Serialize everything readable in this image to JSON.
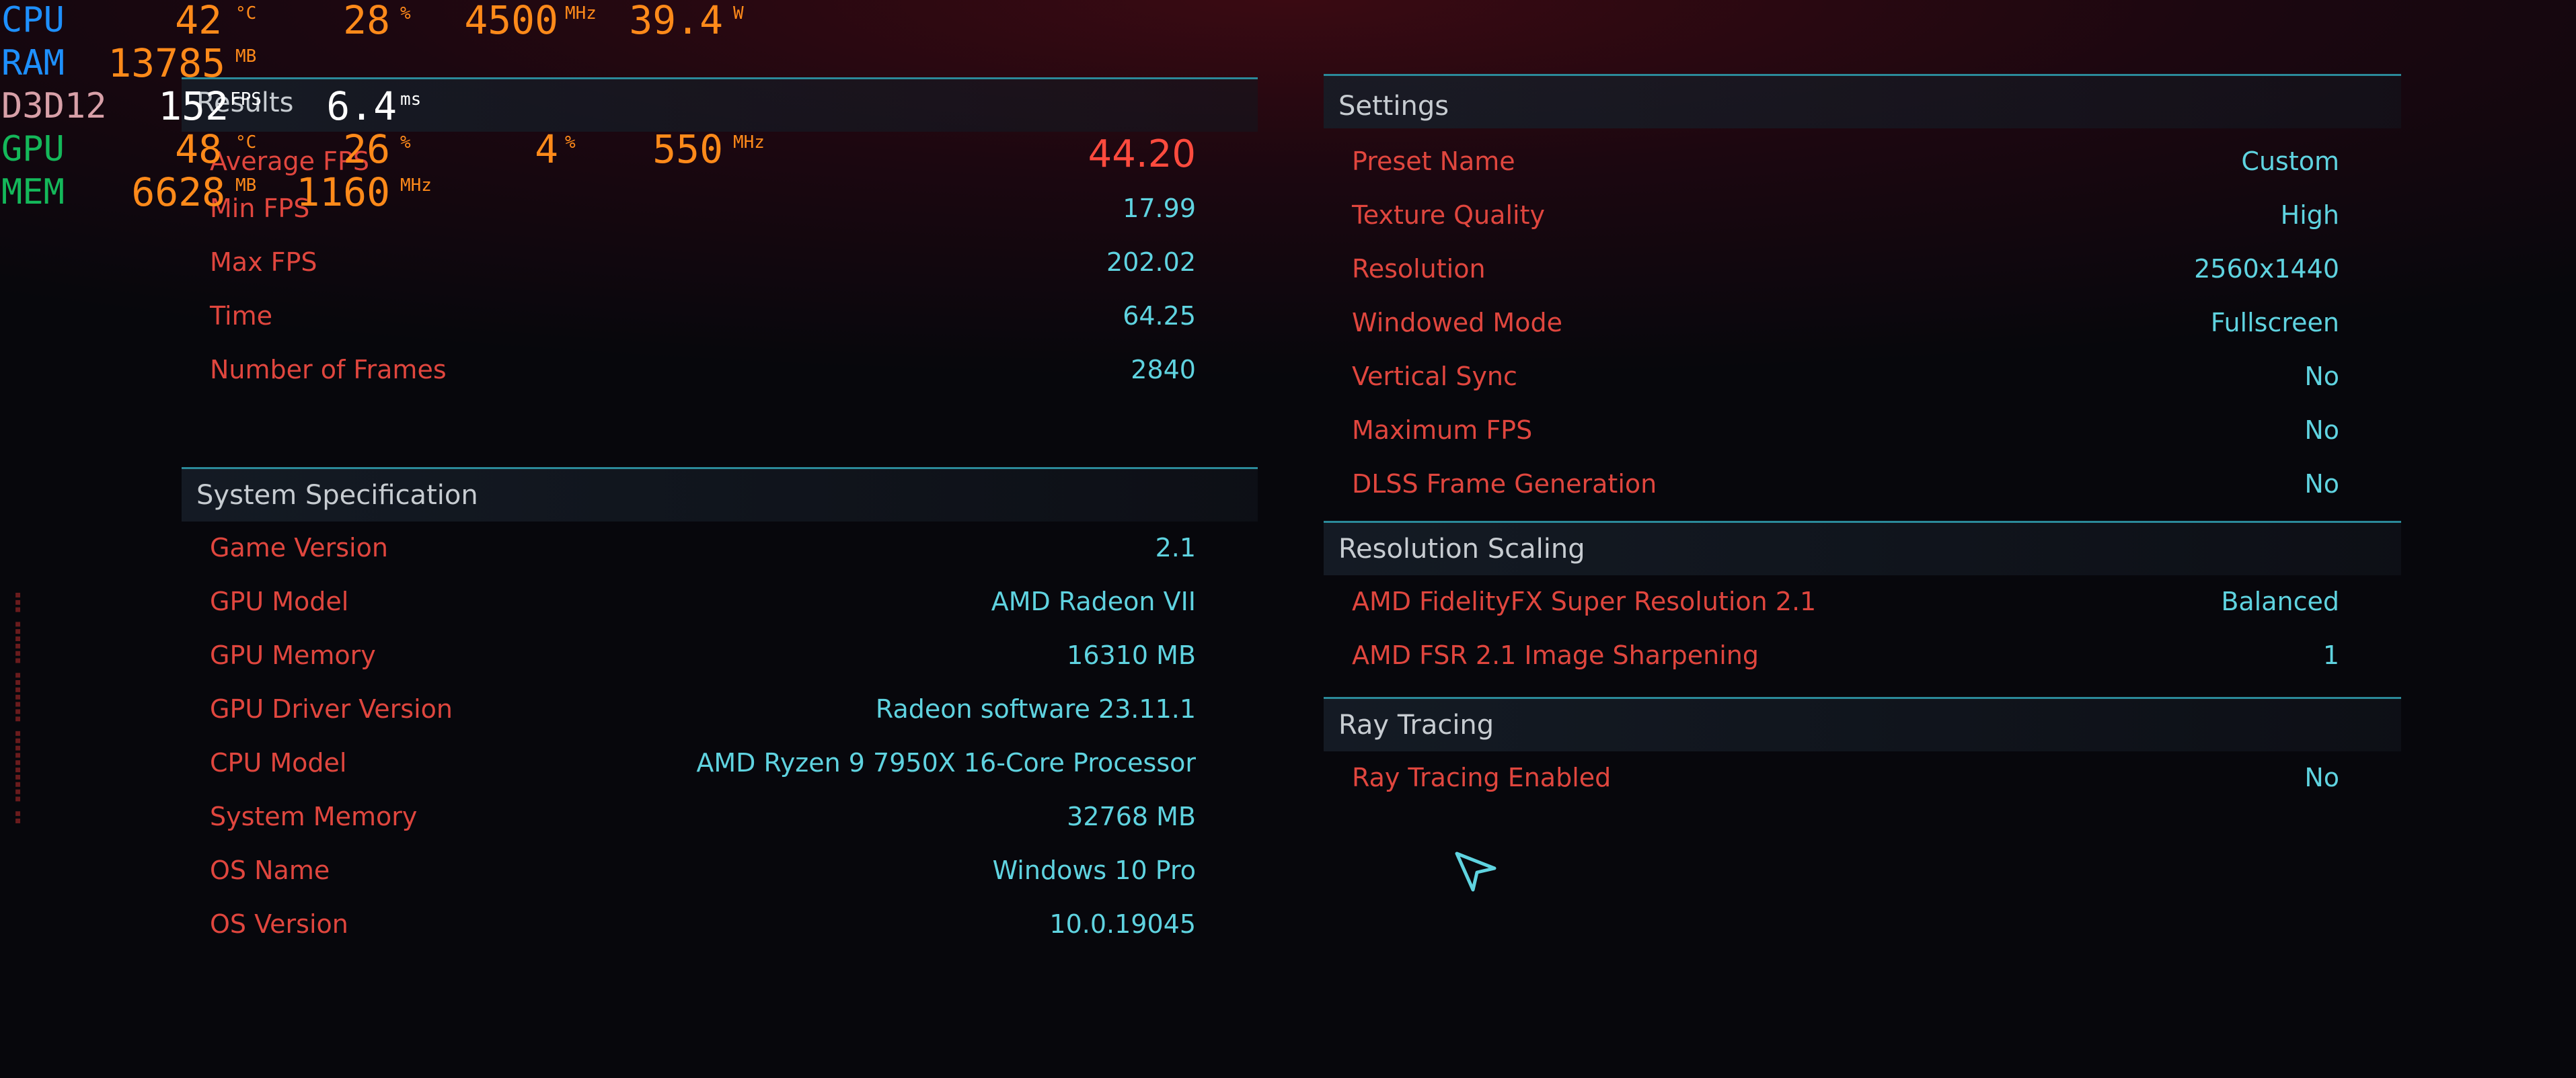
{
  "results": {
    "title": "Results",
    "rows": [
      {
        "label": "Average FPS",
        "value": "44.20"
      },
      {
        "label": "Min FPS",
        "value": "17.99"
      },
      {
        "label": "Max FPS",
        "value": "202.02"
      },
      {
        "label": "Time",
        "value": "64.25"
      },
      {
        "label": "Number of Frames",
        "value": "2840"
      }
    ]
  },
  "system_spec": {
    "title": "System Specification",
    "rows": [
      {
        "label": "Game Version",
        "value": "2.1"
      },
      {
        "label": "GPU Model",
        "value": "AMD Radeon VII"
      },
      {
        "label": "GPU Memory",
        "value": "16310 MB"
      },
      {
        "label": "GPU Driver Version",
        "value": "Radeon software 23.11.1"
      },
      {
        "label": "CPU Model",
        "value": "AMD Ryzen 9 7950X 16-Core Processor"
      },
      {
        "label": "System Memory",
        "value": "32768 MB"
      },
      {
        "label": "OS Name",
        "value": "Windows 10 Pro"
      },
      {
        "label": "OS Version",
        "value": "10.0.19045"
      }
    ]
  },
  "settings": {
    "title": "Settings",
    "rows": [
      {
        "label": "Preset Name",
        "value": "Custom"
      },
      {
        "label": "Texture Quality",
        "value": "High"
      },
      {
        "label": "Resolution",
        "value": "2560x1440"
      },
      {
        "label": "Windowed Mode",
        "value": "Fullscreen"
      },
      {
        "label": "Vertical Sync",
        "value": "No"
      },
      {
        "label": "Maximum FPS",
        "value": "No"
      },
      {
        "label": "DLSS Frame Generation",
        "value": "No"
      }
    ]
  },
  "resolution_scaling": {
    "title": "Resolution Scaling",
    "rows": [
      {
        "label": "AMD FidelityFX Super Resolution 2.1",
        "value": "Balanced"
      },
      {
        "label": "AMD FSR 2.1 Image Sharpening",
        "value": "1"
      }
    ]
  },
  "ray_tracing": {
    "title": "Ray Tracing",
    "rows": [
      {
        "label": "Ray Tracing Enabled",
        "value": "No"
      }
    ]
  },
  "overlay": {
    "cpu": {
      "label": "CPU",
      "temp": "42",
      "temp_unit": "°C",
      "load": "28",
      "load_unit": "%",
      "clock": "4500",
      "clock_unit": "MHz",
      "power": "39.4",
      "power_unit": "W"
    },
    "ram": {
      "label": "RAM",
      "value": "13785",
      "unit": "MB"
    },
    "d3d": {
      "label": "D3D12",
      "fps": "152",
      "fps_unit": "FPS",
      "frametime": "6.4",
      "frametime_unit": "ms"
    },
    "gpu": {
      "label": "GPU",
      "temp": "48",
      "temp_unit": "°C",
      "load": "26",
      "load_unit": "%",
      "val3": "4",
      "val3_unit": "%",
      "clock": "550",
      "clock_unit": "MHz"
    },
    "mem": {
      "label": "MEM",
      "value": "6628",
      "unit": "MB",
      "clock": "1160",
      "clock_unit": "MHz"
    },
    "colors": {
      "cpu": "#1e90ff",
      "ram": "#1e90ff",
      "d3d": "#d8a0a8",
      "gpu": "#14b85a",
      "mem": "#14b85a",
      "value": "#ff8a1a"
    }
  },
  "colors": {
    "label": "#e0463e",
    "value": "#5fd3e0",
    "accent_line": "#2b8a9a",
    "highlight": "#ff4b3e"
  }
}
